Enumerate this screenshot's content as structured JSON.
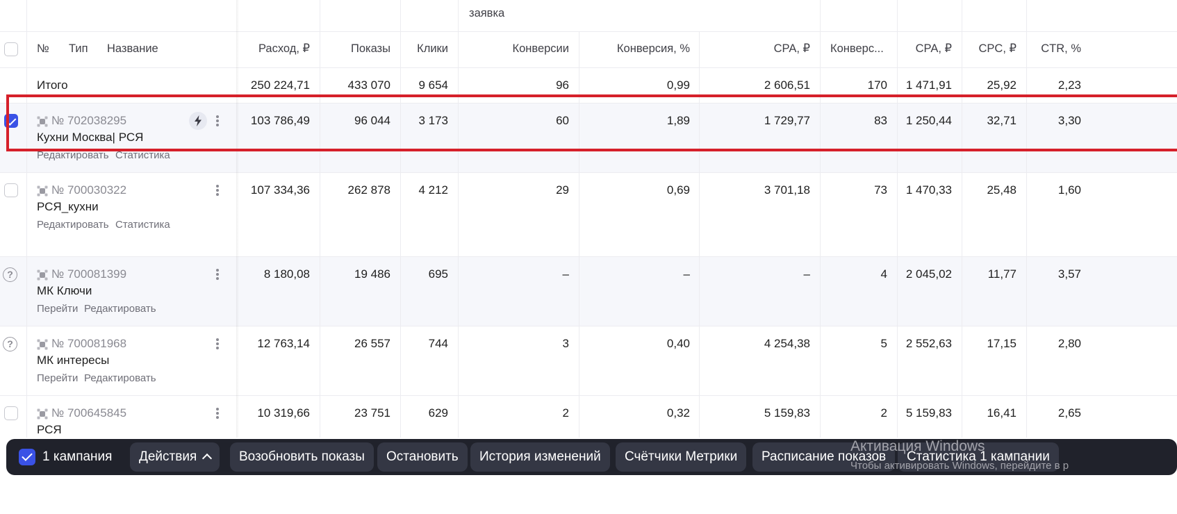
{
  "header": {
    "group_label": "заявка",
    "num": "№",
    "type": "Тип",
    "name": "Название",
    "columns": [
      "Расход, ₽",
      "Показы",
      "Клики",
      "Конверсии",
      "Конверсия, %",
      "CPA, ₽",
      "Конверс...",
      "CPA, ₽",
      "CPC, ₽",
      "CTR, %"
    ]
  },
  "totals": {
    "label": "Итого",
    "values": [
      "250 224,71",
      "433 070",
      "9 654",
      "96",
      "0,99",
      "2 606,51",
      "170",
      "1 471,91",
      "25,92",
      "2,23"
    ]
  },
  "campaigns": [
    {
      "id": "№ 702038295",
      "name": "Кухни Москва| РСЯ",
      "actions": [
        "Редактировать",
        "Статистика"
      ],
      "values": [
        "103 786,49",
        "96 044",
        "3 173",
        "60",
        "1,89",
        "1 729,77",
        "83",
        "1 250,44",
        "32,71",
        "3,30"
      ]
    },
    {
      "id": "№ 700030322",
      "name": "РСЯ_кухни",
      "actions": [
        "Редактировать",
        "Статистика"
      ],
      "values": [
        "107 334,36",
        "262 878",
        "4 212",
        "29",
        "0,69",
        "3 701,18",
        "73",
        "1 470,33",
        "25,48",
        "1,60"
      ]
    },
    {
      "id": "№ 700081399",
      "name": "МК Ключи",
      "actions": [
        "Перейти",
        "Редактировать"
      ],
      "values": [
        "8 180,08",
        "19 486",
        "695",
        "–",
        "–",
        "–",
        "4",
        "2 045,02",
        "11,77",
        "3,57"
      ]
    },
    {
      "id": "№ 700081968",
      "name": "МК интересы",
      "actions": [
        "Перейти",
        "Редактировать"
      ],
      "values": [
        "12 763,14",
        "26 557",
        "744",
        "3",
        "0,40",
        "4 254,38",
        "5",
        "2 552,63",
        "17,15",
        "2,80"
      ]
    },
    {
      "id": "№ 700645845",
      "name": "РСЯ",
      "actions": [],
      "values": [
        "10 319,66",
        "23 751",
        "629",
        "2",
        "0,32",
        "5 159,83",
        "2",
        "5 159,83",
        "16,41",
        "2,65"
      ]
    }
  ],
  "action_bar": {
    "selected_label": "1 кампания",
    "buttons": [
      "Действия",
      "Возобновить показы",
      "Остановить",
      "История изменений",
      "Счётчики Метрики",
      "Расписание показов",
      "Статистика 1 кампании"
    ]
  },
  "watermark": {
    "line1": "Активация Windows",
    "line2": "Чтобы активировать Windows, перейдите в р"
  },
  "colors": {
    "accent": "#3a52e6",
    "highlight": "#d6202a",
    "bar_bg": "#20222b"
  }
}
